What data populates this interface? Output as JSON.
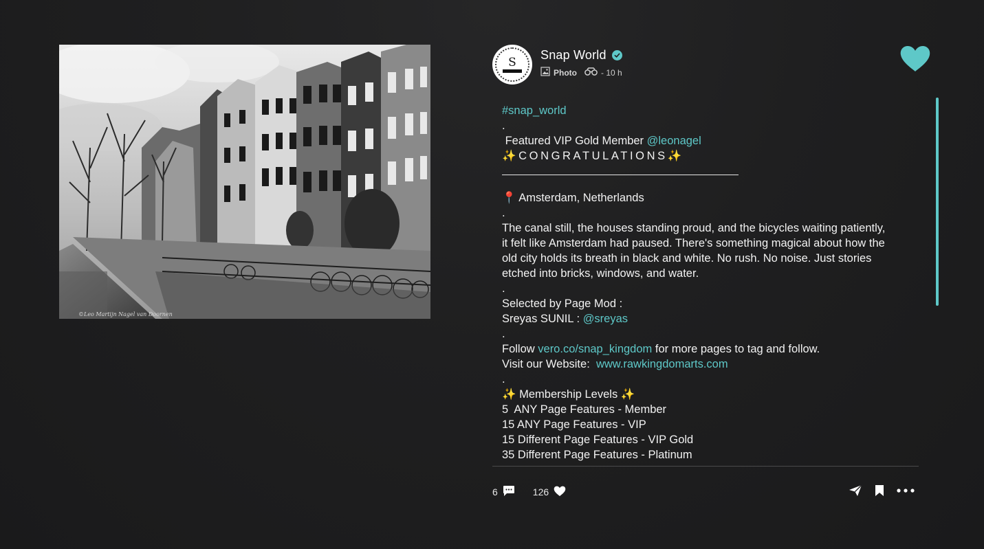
{
  "post": {
    "photo_credit": "©Leo Martijn Nagel van Doornen",
    "account": {
      "name": "Snap World",
      "avatar_letter": "S",
      "verified": true
    },
    "meta": {
      "type_label": "Photo",
      "time": "- 10 h"
    },
    "caption": {
      "hashtag": "#snap_world",
      "dot": ".",
      "featured_prefix": " Featured VIP Gold Member ",
      "featured_handle": "@leonagel",
      "congrats": "✨CONGRATULATIONS✨",
      "location_pin": "📍",
      "location": " Amsterdam, Netherlands",
      "story": "The canal still, the houses standing proud, and the bicycles waiting patiently, it felt like Amsterdam had paused. There's something magical about how the old city holds its breath in black and white. No rush. No noise. Just stories etched into bricks, windows, and water.",
      "selected_by": "Selected by Page Mod :",
      "mod_prefix": "Sreyas SUNIL : ",
      "mod_handle": "@sreyas",
      "follow_prefix": "Follow ",
      "follow_link": "vero.co/snap_kingdom",
      "follow_suffix": " for more pages to tag and follow.",
      "website_prefix": "Visit our Website:  ",
      "website_link": "www.rawkingdomarts.com",
      "membership_title": "✨ Membership Levels ✨",
      "levels": [
        "5  ANY Page Features - Member",
        "15 ANY Page Features - VIP",
        "15 Different Page Features - VIP Gold",
        "35 Different Page Features - Platinum"
      ]
    },
    "stats": {
      "comments": "6",
      "likes": "126"
    }
  },
  "colors": {
    "accent": "#5ec8c8",
    "background": "#1c1c1d",
    "text": "#f2f2f2"
  },
  "icons": [
    "verified-icon",
    "photo-type-icon",
    "binoculars-icon",
    "heart-icon",
    "comment-icon",
    "like-heart-icon",
    "share-send-icon",
    "bookmark-icon",
    "more-dots-icon"
  ]
}
